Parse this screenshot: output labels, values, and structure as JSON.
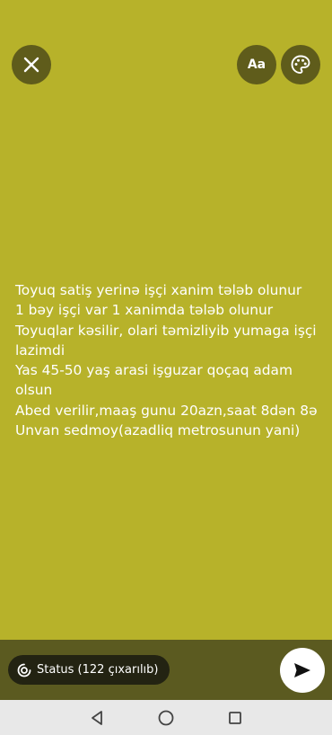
{
  "toolbar": {
    "close_icon": "close-icon",
    "font_label": "Aa",
    "palette_icon": "palette-icon"
  },
  "message": {
    "lines": [
      "Toyuq satiş yerinə işçi xanim tələb olunur",
      "1 bəy işçi var 1 xanimda tələb olunur",
      "Toyuqlar kəsilir, olari təmizliyib yumaga işçi lazimdi",
      "Yas 45-50 yaş arasi işguzar qoçaq adam olsun",
      "Abed verilir,maaş gunu 20azn,saat 8dən 8ə",
      "Unvan sedmoy(azadliq metrosunun yani)"
    ]
  },
  "status": {
    "label": "Status (122 çıxarılıb)",
    "icon": "status-ring-icon"
  },
  "send": {
    "icon": "send-icon"
  },
  "colors": {
    "background": "#b7b22a",
    "button": "#5f5c1b",
    "bottom_bar": "#5b5a20"
  },
  "navigation": {
    "back_icon": "nav-back-icon",
    "home_icon": "nav-home-icon",
    "recents_icon": "nav-recents-icon"
  }
}
